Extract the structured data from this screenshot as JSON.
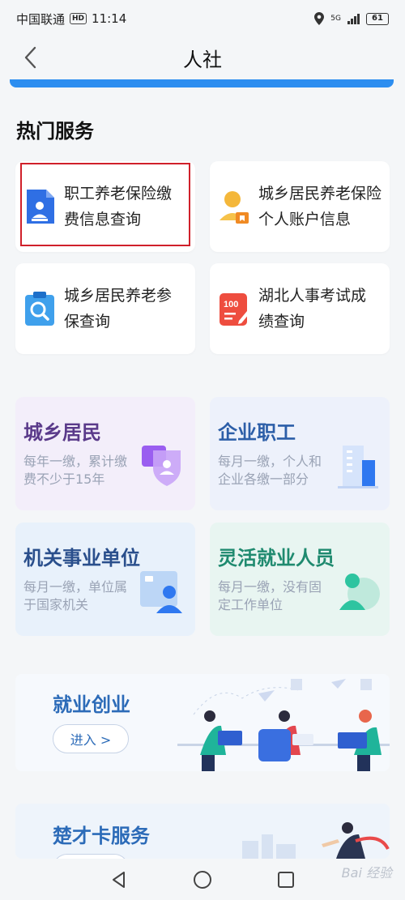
{
  "status_bar": {
    "carrier": "中国联通",
    "hd": "HD",
    "time": "11:14",
    "network": "5G",
    "battery": "61"
  },
  "header": {
    "title": "人社",
    "back_icon": "chevron-left-icon"
  },
  "hot_services": {
    "title": "热门服务",
    "items": [
      {
        "label_line1": "职工养老保险缴",
        "label_line2": "费信息查询",
        "icon": "document-person-icon",
        "highlighted": true
      },
      {
        "label_line1": "城乡居民养老保险",
        "label_line2": "个人账户信息",
        "icon": "person-card-icon"
      },
      {
        "label_line1": "城乡居民养老参",
        "label_line2": "保查询",
        "icon": "clipboard-search-icon"
      },
      {
        "label_line1": "湖北人事考试成",
        "label_line2": "绩查询",
        "icon": "score-100-icon"
      }
    ]
  },
  "categories": [
    {
      "title": "城乡居民",
      "desc": "每年一缴，累计缴费不少于15年",
      "color": "#5a3a8a",
      "bg": "#f3eefa",
      "icon": "shield-person-icon"
    },
    {
      "title": "企业职工",
      "desc": "每月一缴，个人和企业各缴一部分",
      "color": "#2c5ea8",
      "bg": "#edf1fb",
      "icon": "building-icon"
    },
    {
      "title": "机关事业单位",
      "desc": "每月一缴，单位属于国家机关",
      "color": "#2a4f8c",
      "bg": "#e8f1fb",
      "icon": "office-person-icon"
    },
    {
      "title": "灵活就业人员",
      "desc": "每月一缴，没有固定工作单位",
      "color": "#1f8a6f",
      "bg": "#e8f5f1",
      "icon": "person-globe-icon"
    }
  ],
  "banners": [
    {
      "title": "就业创业",
      "button": "进入 >"
    },
    {
      "title": "楚才卡服务",
      "button": ""
    }
  ],
  "nav": {
    "back": "back-triangle-icon",
    "home": "home-circle-icon",
    "recent": "recent-square-icon"
  },
  "watermark": "Bai 经验"
}
